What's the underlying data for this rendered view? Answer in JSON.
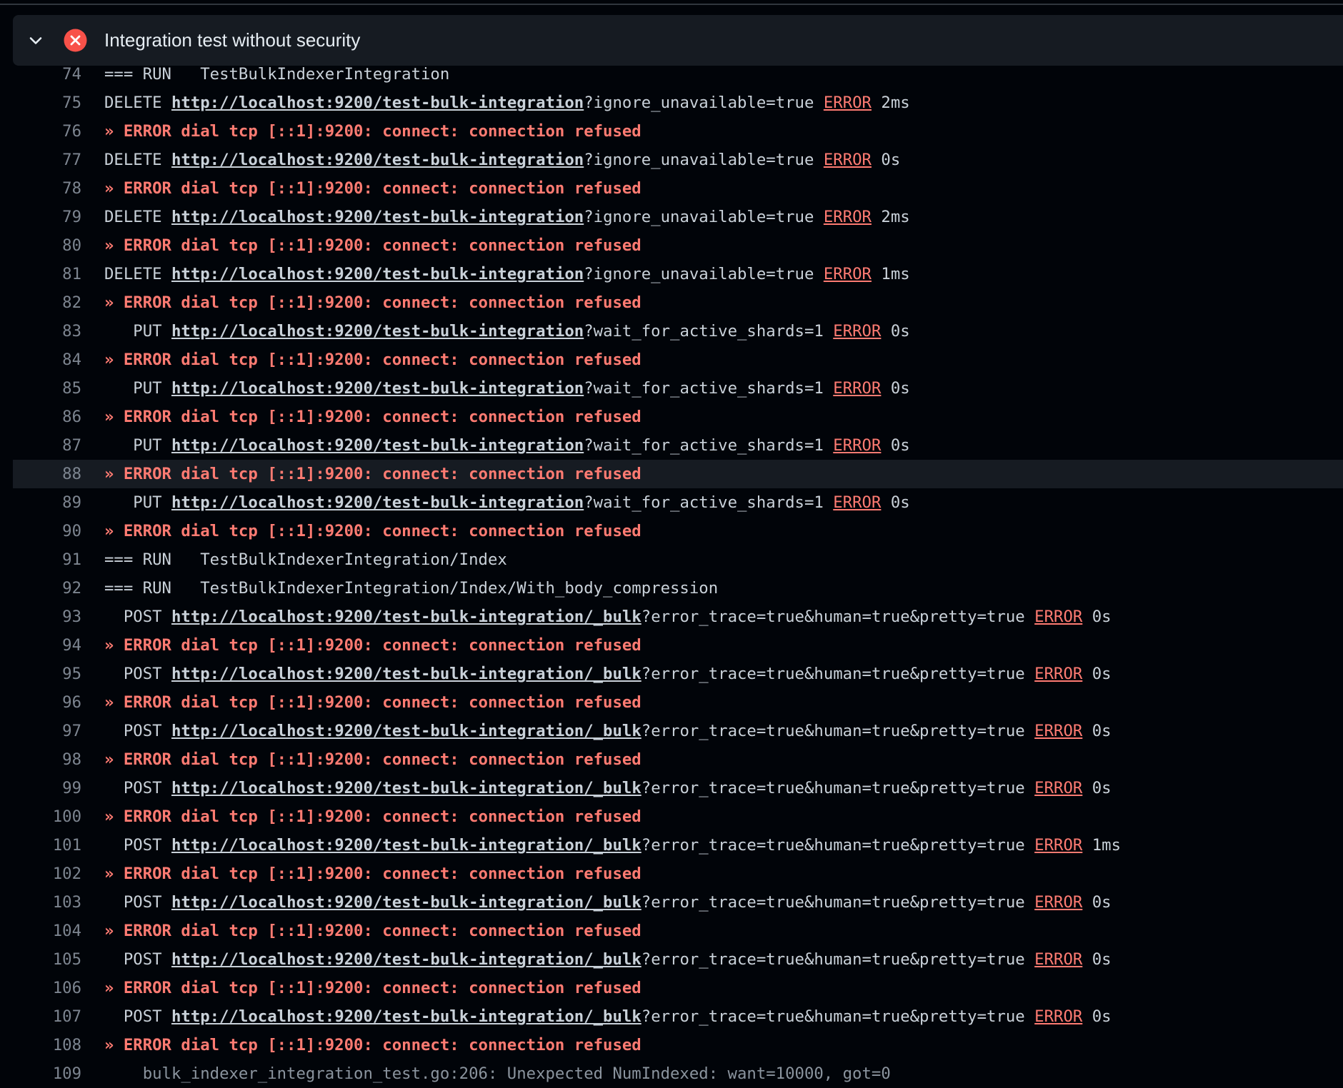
{
  "step": {
    "title": "Integration test without security",
    "status": "failed",
    "expanded": true,
    "status_color": "#f85149"
  },
  "log_lines": [
    {
      "num": "74",
      "kind": "text",
      "text": "=== RUN   TestBulkIndexerIntegration"
    },
    {
      "num": "75",
      "kind": "req",
      "method": "DELETE",
      "url": "http://localhost:9200/test-bulk-integration",
      "query": "?ignore_unavailable=true",
      "status": "ERROR",
      "time": "2ms"
    },
    {
      "num": "76",
      "kind": "err",
      "text": "» ERROR dial tcp [::1]:9200: connect: connection refused"
    },
    {
      "num": "77",
      "kind": "req",
      "method": "DELETE",
      "url": "http://localhost:9200/test-bulk-integration",
      "query": "?ignore_unavailable=true",
      "status": "ERROR",
      "time": "0s"
    },
    {
      "num": "78",
      "kind": "err",
      "text": "» ERROR dial tcp [::1]:9200: connect: connection refused"
    },
    {
      "num": "79",
      "kind": "req",
      "method": "DELETE",
      "url": "http://localhost:9200/test-bulk-integration",
      "query": "?ignore_unavailable=true",
      "status": "ERROR",
      "time": "2ms"
    },
    {
      "num": "80",
      "kind": "err",
      "text": "» ERROR dial tcp [::1]:9200: connect: connection refused"
    },
    {
      "num": "81",
      "kind": "req",
      "method": "DELETE",
      "url": "http://localhost:9200/test-bulk-integration",
      "query": "?ignore_unavailable=true",
      "status": "ERROR",
      "time": "1ms"
    },
    {
      "num": "82",
      "kind": "err",
      "text": "» ERROR dial tcp [::1]:9200: connect: connection refused"
    },
    {
      "num": "83",
      "kind": "req",
      "method": "   PUT",
      "url": "http://localhost:9200/test-bulk-integration",
      "query": "?wait_for_active_shards=1",
      "status": "ERROR",
      "time": "0s"
    },
    {
      "num": "84",
      "kind": "err",
      "text": "» ERROR dial tcp [::1]:9200: connect: connection refused"
    },
    {
      "num": "85",
      "kind": "req",
      "method": "   PUT",
      "url": "http://localhost:9200/test-bulk-integration",
      "query": "?wait_for_active_shards=1",
      "status": "ERROR",
      "time": "0s"
    },
    {
      "num": "86",
      "kind": "err",
      "text": "» ERROR dial tcp [::1]:9200: connect: connection refused"
    },
    {
      "num": "87",
      "kind": "req",
      "method": "   PUT",
      "url": "http://localhost:9200/test-bulk-integration",
      "query": "?wait_for_active_shards=1",
      "status": "ERROR",
      "time": "0s"
    },
    {
      "num": "88",
      "kind": "err",
      "text": "» ERROR dial tcp [::1]:9200: connect: connection refused",
      "highlighted": true
    },
    {
      "num": "89",
      "kind": "req",
      "method": "   PUT",
      "url": "http://localhost:9200/test-bulk-integration",
      "query": "?wait_for_active_shards=1",
      "status": "ERROR",
      "time": "0s"
    },
    {
      "num": "90",
      "kind": "err",
      "text": "» ERROR dial tcp [::1]:9200: connect: connection refused"
    },
    {
      "num": "91",
      "kind": "text",
      "text": "=== RUN   TestBulkIndexerIntegration/Index"
    },
    {
      "num": "92",
      "kind": "text",
      "text": "=== RUN   TestBulkIndexerIntegration/Index/With_body_compression"
    },
    {
      "num": "93",
      "kind": "req",
      "method": "  POST",
      "url": "http://localhost:9200/test-bulk-integration/_bulk",
      "query": "?error_trace=true&human=true&pretty=true",
      "status": "ERROR",
      "time": "0s"
    },
    {
      "num": "94",
      "kind": "err",
      "text": "» ERROR dial tcp [::1]:9200: connect: connection refused"
    },
    {
      "num": "95",
      "kind": "req",
      "method": "  POST",
      "url": "http://localhost:9200/test-bulk-integration/_bulk",
      "query": "?error_trace=true&human=true&pretty=true",
      "status": "ERROR",
      "time": "0s"
    },
    {
      "num": "96",
      "kind": "err",
      "text": "» ERROR dial tcp [::1]:9200: connect: connection refused"
    },
    {
      "num": "97",
      "kind": "req",
      "method": "  POST",
      "url": "http://localhost:9200/test-bulk-integration/_bulk",
      "query": "?error_trace=true&human=true&pretty=true",
      "status": "ERROR",
      "time": "0s"
    },
    {
      "num": "98",
      "kind": "err",
      "text": "» ERROR dial tcp [::1]:9200: connect: connection refused"
    },
    {
      "num": "99",
      "kind": "req",
      "method": "  POST",
      "url": "http://localhost:9200/test-bulk-integration/_bulk",
      "query": "?error_trace=true&human=true&pretty=true",
      "status": "ERROR",
      "time": "0s"
    },
    {
      "num": "100",
      "kind": "err",
      "text": "» ERROR dial tcp [::1]:9200: connect: connection refused"
    },
    {
      "num": "101",
      "kind": "req",
      "method": "  POST",
      "url": "http://localhost:9200/test-bulk-integration/_bulk",
      "query": "?error_trace=true&human=true&pretty=true",
      "status": "ERROR",
      "time": "1ms"
    },
    {
      "num": "102",
      "kind": "err",
      "text": "» ERROR dial tcp [::1]:9200: connect: connection refused"
    },
    {
      "num": "103",
      "kind": "req",
      "method": "  POST",
      "url": "http://localhost:9200/test-bulk-integration/_bulk",
      "query": "?error_trace=true&human=true&pretty=true",
      "status": "ERROR",
      "time": "0s"
    },
    {
      "num": "104",
      "kind": "err",
      "text": "» ERROR dial tcp [::1]:9200: connect: connection refused"
    },
    {
      "num": "105",
      "kind": "req",
      "method": "  POST",
      "url": "http://localhost:9200/test-bulk-integration/_bulk",
      "query": "?error_trace=true&human=true&pretty=true",
      "status": "ERROR",
      "time": "0s"
    },
    {
      "num": "106",
      "kind": "err",
      "text": "» ERROR dial tcp [::1]:9200: connect: connection refused"
    },
    {
      "num": "107",
      "kind": "req",
      "method": "  POST",
      "url": "http://localhost:9200/test-bulk-integration/_bulk",
      "query": "?error_trace=true&human=true&pretty=true",
      "status": "ERROR",
      "time": "0s"
    },
    {
      "num": "108",
      "kind": "err",
      "text": "» ERROR dial tcp [::1]:9200: connect: connection refused"
    },
    {
      "num": "109",
      "kind": "text",
      "text": "    bulk_indexer_integration_test.go:206: Unexpected NumIndexed: want=10000, got=0",
      "cut": true
    }
  ],
  "colors": {
    "background": "#010409",
    "header_background": "#161b22",
    "error_text": "#ff7b72",
    "line_number": "#7d8590",
    "log_text": "#c9d1d9"
  }
}
